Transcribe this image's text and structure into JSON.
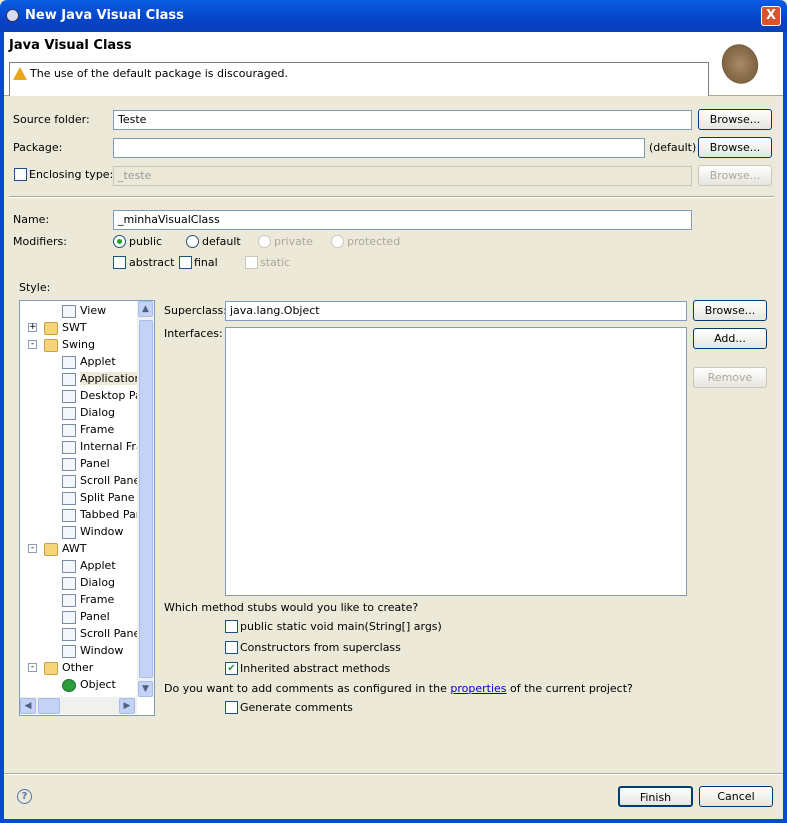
{
  "window": {
    "title": "New Java Visual Class",
    "close": "X"
  },
  "header": {
    "title": "Java Visual Class",
    "message": "The use of the default package is discouraged."
  },
  "form": {
    "source_folder_label": "Source folder:",
    "source_folder": "Teste",
    "package_label": "Package:",
    "package": "",
    "package_default": "(default)",
    "enclosing_label": "Enclosing type:",
    "enclosing": "_teste",
    "browse": "Browse...",
    "name_label": "Name:",
    "name": "_minhaVisualClass",
    "modifiers_label": "Modifiers:",
    "mod_public": "public",
    "mod_default": "default",
    "mod_private": "private",
    "mod_protected": "protected",
    "mod_abstract": "abstract",
    "mod_final": "final",
    "mod_static": "static",
    "style_label": "Style:",
    "superclass_label": "Superclass:",
    "superclass": "java.lang.Object",
    "interfaces_label": "Interfaces:",
    "add": "Add...",
    "remove": "Remove",
    "stubs_question": "Which method stubs would you like to create?",
    "stub_main": "public static void main(String[] args)",
    "stub_ctor": "Constructors from superclass",
    "stub_inherited": "Inherited abstract methods",
    "comments_q_pre": "Do you want to add comments as configured in the ",
    "comments_link": "properties",
    "comments_q_post": " of the current project?",
    "generate_comments": "Generate comments"
  },
  "tree": [
    {
      "label": "View",
      "level": 2,
      "icon": "view"
    },
    {
      "label": "SWT",
      "level": 1,
      "icon": "folder",
      "exp": "+"
    },
    {
      "label": "Swing",
      "level": 1,
      "icon": "folder",
      "exp": "-"
    },
    {
      "label": "Applet",
      "level": 2,
      "icon": "applet"
    },
    {
      "label": "Application",
      "level": 2,
      "icon": "frame",
      "selected": true
    },
    {
      "label": "Desktop Pa",
      "level": 2,
      "icon": "desktop"
    },
    {
      "label": "Dialog",
      "level": 2,
      "icon": "dialog"
    },
    {
      "label": "Frame",
      "level": 2,
      "icon": "frame"
    },
    {
      "label": "Internal Fra",
      "level": 2,
      "icon": "internal"
    },
    {
      "label": "Panel",
      "level": 2,
      "icon": "panel"
    },
    {
      "label": "Scroll Pane",
      "level": 2,
      "icon": "scroll"
    },
    {
      "label": "Split Pane",
      "level": 2,
      "icon": "split"
    },
    {
      "label": "Tabbed Par",
      "level": 2,
      "icon": "tabbed"
    },
    {
      "label": "Window",
      "level": 2,
      "icon": "window"
    },
    {
      "label": "AWT",
      "level": 1,
      "icon": "folder",
      "exp": "-"
    },
    {
      "label": "Applet",
      "level": 2,
      "icon": "applet"
    },
    {
      "label": "Dialog",
      "level": 2,
      "icon": "dialog"
    },
    {
      "label": "Frame",
      "level": 2,
      "icon": "frame"
    },
    {
      "label": "Panel",
      "level": 2,
      "icon": "panel"
    },
    {
      "label": "Scroll Pane",
      "level": 2,
      "icon": "scroll"
    },
    {
      "label": "Window",
      "level": 2,
      "icon": "window"
    },
    {
      "label": "Other",
      "level": 1,
      "icon": "folder",
      "exp": "-"
    },
    {
      "label": "Object",
      "level": 2,
      "icon": "obj"
    }
  ],
  "footer": {
    "help": "?",
    "finish": "Finish",
    "cancel": "Cancel"
  }
}
